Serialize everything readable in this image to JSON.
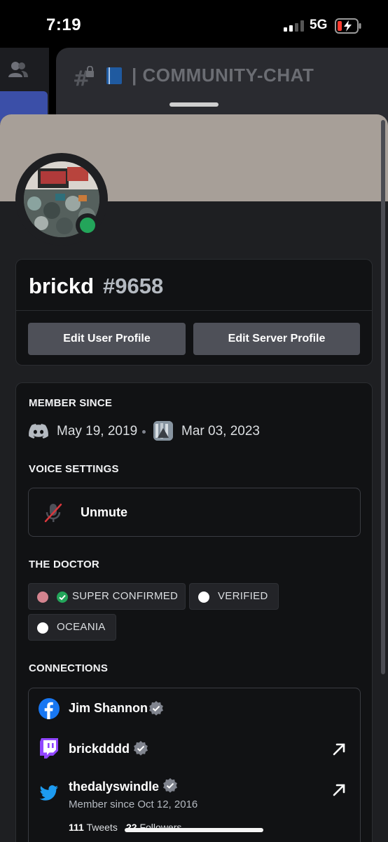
{
  "status_bar": {
    "time": "7:19",
    "network": "5G"
  },
  "background": {
    "channel_name": "| COMMUNITY-CHAT",
    "close_glyph": "✕"
  },
  "profile": {
    "username": "brickd",
    "discriminator": "#9658",
    "banner_color": "#a79f98",
    "status": "online",
    "status_color": "#23a55a",
    "edit_user_label": "Edit User Profile",
    "edit_server_label": "Edit Server Profile"
  },
  "member_since": {
    "title": "MEMBER SINCE",
    "discord_date": "May 19, 2019",
    "server_date": "Mar 03, 2023"
  },
  "voice": {
    "title": "VOICE SETTINGS",
    "button_label": "Unmute"
  },
  "roles": {
    "title": "THE DOCTOR",
    "items": [
      {
        "label": "SUPER CONFIRMED",
        "color": "#d4848f",
        "icon": "green-check-icon"
      },
      {
        "label": "VERIFIED",
        "color": "#ffffff"
      },
      {
        "label": "OCEANIA",
        "color": "#ffffff"
      }
    ]
  },
  "connections": {
    "title": "CONNECTIONS",
    "items": [
      {
        "service": "facebook",
        "name": "Jim Shannon",
        "verified": true
      },
      {
        "service": "twitch",
        "name": "brickdddd",
        "verified": true
      },
      {
        "service": "twitter",
        "name": "thedalyswindle",
        "verified": true,
        "member_since": "Member since Oct 12, 2016",
        "tweets_count": "111",
        "tweets_label": "Tweets",
        "followers_count": "22",
        "followers_label": "Followers"
      }
    ]
  }
}
